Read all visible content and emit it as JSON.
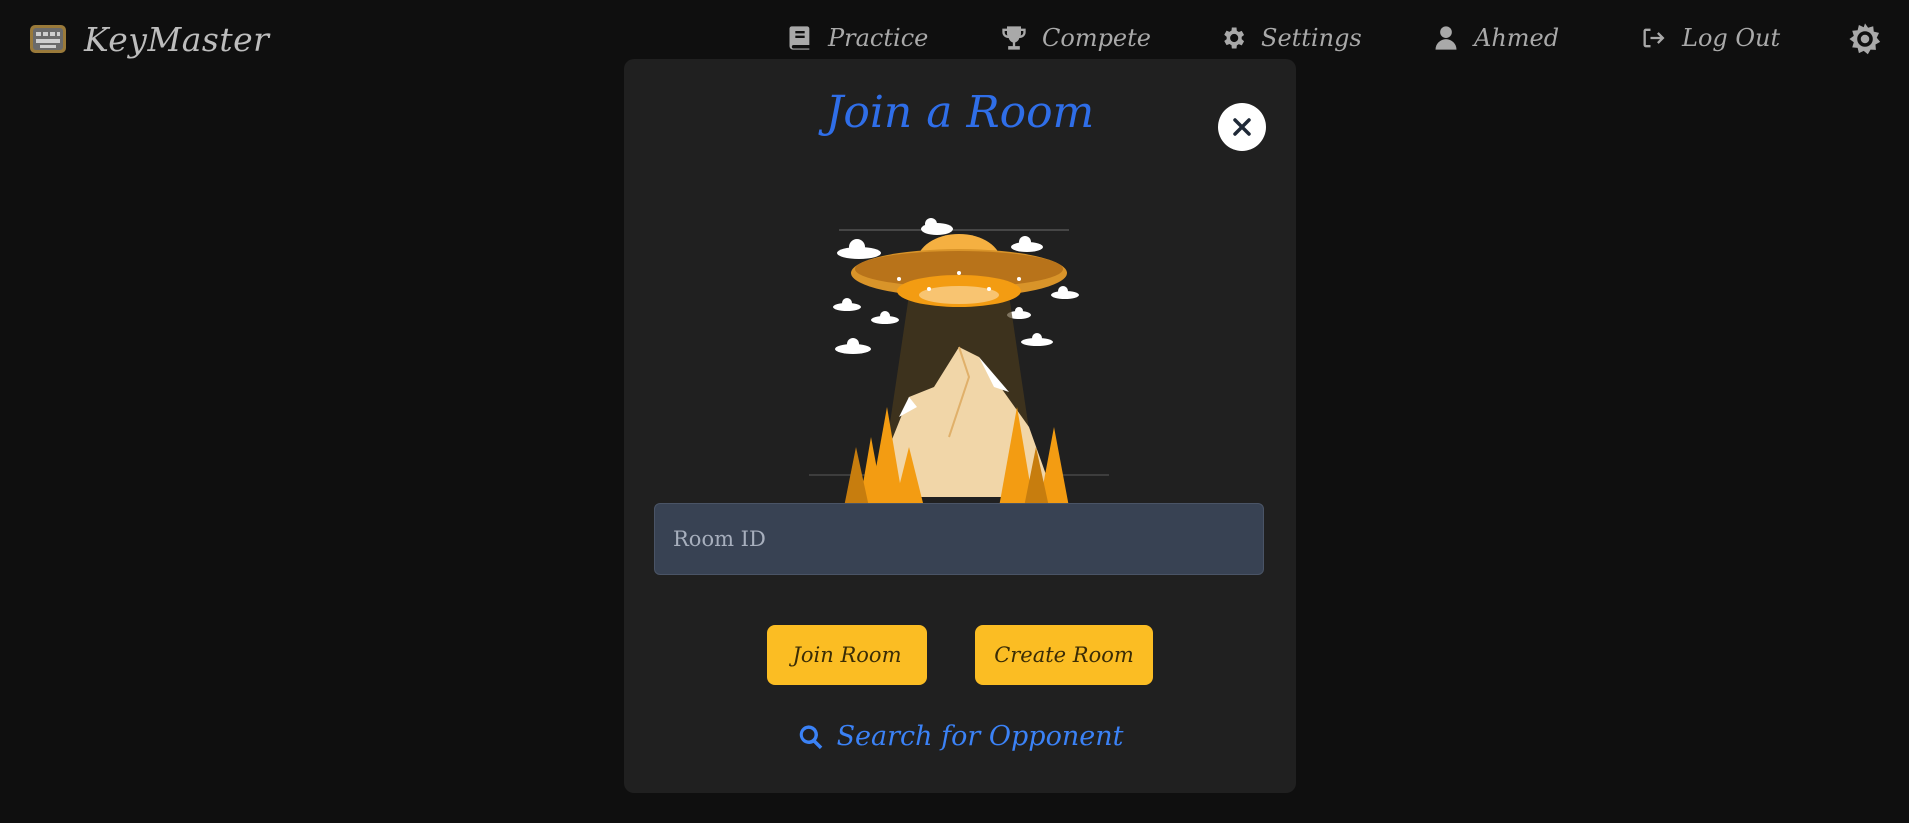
{
  "app": {
    "name": "KeyMaster"
  },
  "nav": {
    "items": [
      {
        "label": "Practice",
        "icon": "book-icon"
      },
      {
        "label": "Compete",
        "icon": "trophy-icon"
      },
      {
        "label": "Settings",
        "icon": "gear-icon"
      },
      {
        "label": "Ahmed",
        "icon": "user-icon"
      },
      {
        "label": "Log Out",
        "icon": "logout-icon"
      }
    ],
    "theme_toggle_icon": "sun-icon"
  },
  "modal": {
    "title": "Join a Room",
    "close_icon": "close-icon",
    "illustration": "ufo-mountain-illustration",
    "room_input": {
      "placeholder": "Room ID",
      "value": ""
    },
    "join_label": "Join Room",
    "create_label": "Create Room",
    "search_label": "Search for Opponent",
    "search_icon": "search-icon"
  },
  "colors": {
    "background": "#0f0f0f",
    "modal": "#202020",
    "accent_blue": "#2f6ee8",
    "button_yellow": "#fbbd23",
    "input_bg": "#384253"
  }
}
